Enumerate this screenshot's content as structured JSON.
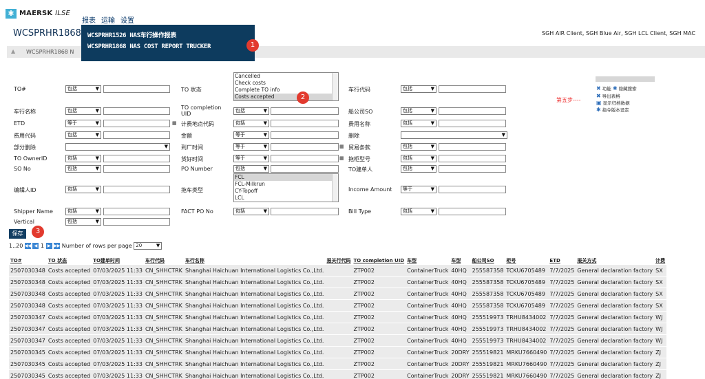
{
  "brand": {
    "logo_text": "MAERSK",
    "logo_suffix": "ILSE"
  },
  "nav": [
    "报表",
    "运输",
    "设置"
  ],
  "page_title": "WCSPRHR1868",
  "clients_text": "SGH AIR Client, SGH Blue Air, SGH LCL Client, SGH MAC",
  "breadcrumb": "WCSPRHR1868 N",
  "popup": {
    "items": [
      "WCSPRHR1526 NAS车行操作报表",
      "WCSPRHR1868 NAS COST REPORT TRUCKER"
    ]
  },
  "badges": [
    "1",
    "2",
    "3"
  ],
  "step5": "第五步----",
  "filters": {
    "col1": [
      {
        "label": "TO#",
        "op": "包括"
      },
      {
        "label": "车行名称",
        "op": "包括"
      },
      {
        "label": "ETD",
        "op": "等于"
      },
      {
        "label": "费用代码",
        "op": "包括"
      },
      {
        "label": "部分删除",
        "op": ""
      },
      {
        "label": "TO OwnerID",
        "op": "包括"
      },
      {
        "label": "SO No",
        "op": "包括"
      },
      {
        "label": "编辑人ID",
        "op": "包括"
      },
      {
        "label": "Shipper Name",
        "op": "包括"
      },
      {
        "label": "Vertical",
        "op": "包括"
      }
    ],
    "col2": [
      {
        "label": "TO 状态",
        "op": ""
      },
      {
        "label": "TO completion UID",
        "op": "包括"
      },
      {
        "label": "计费地点代码",
        "op": "包括"
      },
      {
        "label": "金额",
        "op": "等于"
      },
      {
        "label": "到厂时间",
        "op": "等于"
      },
      {
        "label": "货好时间",
        "op": "等于"
      },
      {
        "label": "PO Number",
        "op": "包括"
      },
      {
        "label": "拖车类型",
        "op": ""
      },
      {
        "label": "FACT PO No",
        "op": "包括"
      }
    ],
    "col3": [
      {
        "label": "车行代码",
        "op": "包括"
      },
      {
        "label": "船公司SO",
        "op": "包括"
      },
      {
        "label": "费用名称",
        "op": "包括"
      },
      {
        "label": "删除",
        "op": ""
      },
      {
        "label": "贸易条款",
        "op": "包括"
      },
      {
        "label": "拖柜型号",
        "op": "包括"
      },
      {
        "label": "TO建单人",
        "op": "包括"
      },
      {
        "label": "Income Amount",
        "op": "等于"
      },
      {
        "label": "Bill Type",
        "op": "包括"
      }
    ],
    "status_options": [
      "Cancelled",
      "Check costs",
      "Complete TO info",
      "Costs accepted"
    ],
    "truck_type_options": [
      "FCL",
      "FCL-Milkrun",
      "CY-Topoff",
      "LCL"
    ]
  },
  "functions": [
    "功能",
    "隐藏搜索",
    "导出表格",
    "显示归档数据",
    "指令版本设定"
  ],
  "save_label": "保存",
  "pager": {
    "range": "1..20",
    "page": "1",
    "rows_label": "Number of rows per page",
    "rows_value": "20"
  },
  "table": {
    "headers": [
      "TO#",
      "TO 状态",
      "TO建单时间",
      "车行代码",
      "车行名称",
      "报关行代码",
      "TO completion UID",
      "车型",
      "车型",
      "船公司SO",
      "柜号",
      "ETD",
      "报关方式",
      "计费"
    ],
    "rows": [
      [
        "2507030348",
        "Costs accepted",
        "07/03/2025 11:33",
        "CN_SHHCTRK",
        "Shanghai Haichuan International Logistics Co.,Ltd.",
        "",
        "ZTP002",
        "ContainerTruck",
        "40HQ",
        "255587358",
        "TCKU6705489",
        "7/7/2025",
        "General declaration factory",
        "SX"
      ],
      [
        "2507030348",
        "Costs accepted",
        "07/03/2025 11:33",
        "CN_SHHCTRK",
        "Shanghai Haichuan International Logistics Co.,Ltd.",
        "",
        "ZTP002",
        "ContainerTruck",
        "40HQ",
        "255587358",
        "TCKU6705489",
        "7/7/2025",
        "General declaration factory",
        "SX"
      ],
      [
        "2507030348",
        "Costs accepted",
        "07/03/2025 11:33",
        "CN_SHHCTRK",
        "Shanghai Haichuan International Logistics Co.,Ltd.",
        "",
        "ZTP002",
        "ContainerTruck",
        "40HQ",
        "255587358",
        "TCKU6705489",
        "7/7/2025",
        "General declaration factory",
        "SX"
      ],
      [
        "2507030348",
        "Costs accepted",
        "07/03/2025 11:33",
        "CN_SHHCTRK",
        "Shanghai Haichuan International Logistics Co.,Ltd.",
        "",
        "ZTP002",
        "ContainerTruck",
        "40HQ",
        "255587358",
        "TCKU6705489",
        "7/7/2025",
        "General declaration factory",
        "SX"
      ],
      [
        "2507030347",
        "Costs accepted",
        "07/03/2025 11:33",
        "CN_SHHCTRK",
        "Shanghai Haichuan International Logistics Co.,Ltd.",
        "",
        "ZTP002",
        "ContainerTruck",
        "40HQ",
        "255519973",
        "TRHU8434002",
        "7/7/2025",
        "General declaration factory",
        "WJ"
      ],
      [
        "2507030347",
        "Costs accepted",
        "07/03/2025 11:33",
        "CN_SHHCTRK",
        "Shanghai Haichuan International Logistics Co.,Ltd.",
        "",
        "ZTP002",
        "ContainerTruck",
        "40HQ",
        "255519973",
        "TRHU8434002",
        "7/7/2025",
        "General declaration factory",
        "WJ"
      ],
      [
        "2507030347",
        "Costs accepted",
        "07/03/2025 11:33",
        "CN_SHHCTRK",
        "Shanghai Haichuan International Logistics Co.,Ltd.",
        "",
        "ZTP002",
        "ContainerTruck",
        "40HQ",
        "255519973",
        "TRHU8434002",
        "7/7/2025",
        "General declaration factory",
        "WJ"
      ],
      [
        "2507030345",
        "Costs accepted",
        "07/03/2025 11:33",
        "CN_SHHCTRK",
        "Shanghai Haichuan International Logistics Co.,Ltd.",
        "",
        "ZTP002",
        "ContainerTruck",
        "20DRY",
        "255519821",
        "MRKU7660490",
        "7/7/2025",
        "General declaration factory",
        "ZJ"
      ],
      [
        "2507030345",
        "Costs accepted",
        "07/03/2025 11:33",
        "CN_SHHCTRK",
        "Shanghai Haichuan International Logistics Co.,Ltd.",
        "",
        "ZTP002",
        "ContainerTruck",
        "20DRY",
        "255519821",
        "MRKU7660490",
        "7/7/2025",
        "General declaration factory",
        "ZJ"
      ],
      [
        "2507030345",
        "Costs accepted",
        "07/03/2025 11:33",
        "CN_SHHCTRK",
        "Shanghai Haichuan International Logistics Co.,Ltd.",
        "",
        "ZTP002",
        "ContainerTruck",
        "20DRY",
        "255519821",
        "MRKU7660490",
        "7/7/2025",
        "General declaration factory",
        "ZJ"
      ]
    ]
  }
}
